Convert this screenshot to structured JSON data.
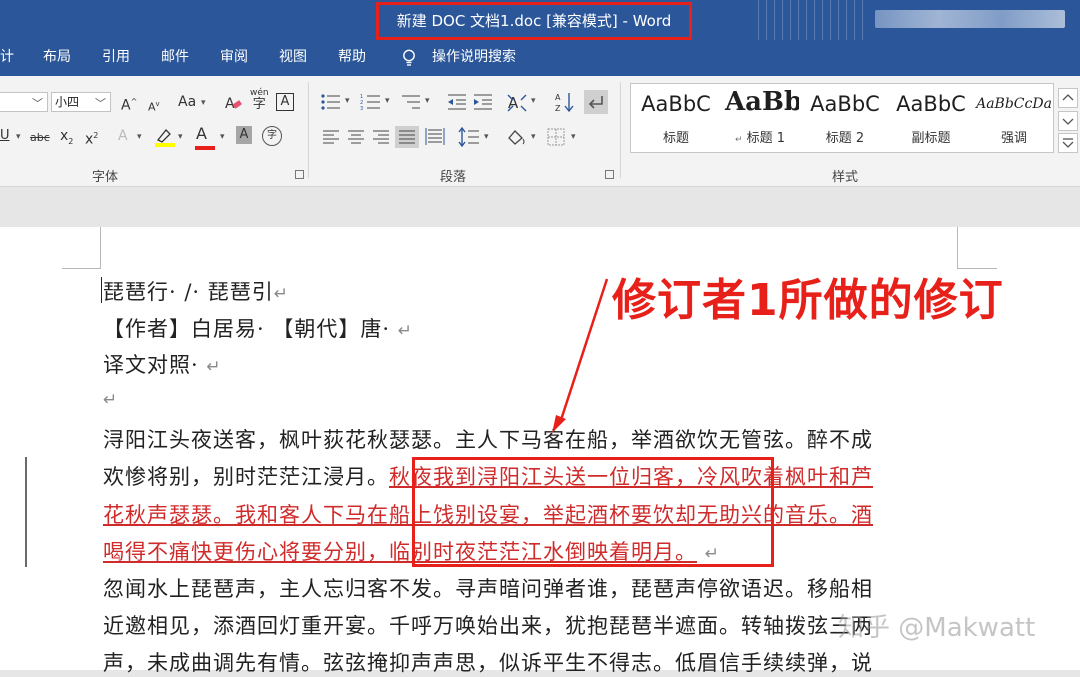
{
  "window": {
    "title": "新建 DOC 文档1.doc [兼容模式]  -  Word"
  },
  "menu": {
    "items": [
      "计",
      "布局",
      "引用",
      "邮件",
      "审阅",
      "视图",
      "帮助"
    ],
    "tell_me": "操作说明搜索"
  },
  "ribbon": {
    "font_size": "小四",
    "font_group_label": "字体",
    "paragraph_group_label": "段落",
    "styles_group_label": "样式",
    "font_buttons": {
      "grow": "A",
      "shrink": "A",
      "change_case": "Aa",
      "phonetic": "wén",
      "phonetic_char": "字",
      "char_border": "A",
      "underline": "U",
      "strike": "abc",
      "subscript": "x",
      "superscript": "x",
      "text_effects": "A",
      "font_color": "A",
      "char_shading": "A",
      "enclose": "字"
    },
    "styles": [
      {
        "preview": "AaBbC",
        "name": "标题"
      },
      {
        "preview": "AaBb",
        "name": "标题 1"
      },
      {
        "preview": "AaBbC",
        "name": "标题 2"
      },
      {
        "preview": "AaBbC",
        "name": "副标题"
      },
      {
        "preview": "AaBbCcDa",
        "name": "强调"
      }
    ],
    "colors": {
      "highlight": "#ffff00",
      "font_color": "#e8201a"
    }
  },
  "document": {
    "lines": [
      {
        "text": "琵琶行· /· 琵琶引",
        "mark": "↵"
      },
      {
        "text": "【作者】白居易· 【朝代】唐· ",
        "mark": "↵"
      },
      {
        "text": "译文对照· ",
        "mark": "↵"
      },
      {
        "text": "",
        "mark": "↵"
      },
      {
        "text": "浔阳江头夜送客，枫叶荻花秋瑟瑟。主人下马客在船，举酒欲饮无管弦。醉不成"
      },
      {
        "text": "欢惨将别，别时茫茫江浸月。",
        "revision": "秋夜我到浔阳江头送一位归客，冷风吹着枫叶和芦"
      },
      {
        "revision": "花秋声瑟瑟。我和客人下马在船上饯别设宴，举起酒杯要饮却无助兴的音乐。酒"
      },
      {
        "revision": "喝得不痛快更伤心将要分别，临别时夜茫茫江水倒映着明月。",
        "mark": "↵"
      },
      {
        "text": "忽闻水上琵琶声，主人忘归客不发。寻声暗问弹者谁，琵琶声停欲语迟。移船相"
      },
      {
        "text": "近邀相见，添酒回灯重开宴。千呼万唤始出来，犹抱琵琶半遮面。转轴拨弦三两"
      },
      {
        "text": "声，未成曲调先有情。弦弦掩抑声声思，似诉平生不得志。低眉信手续续弹，说"
      }
    ]
  },
  "annotation": {
    "label": "修订者1所做的修订",
    "color": "#e8201a"
  },
  "watermark": "知乎 @Makwatt"
}
